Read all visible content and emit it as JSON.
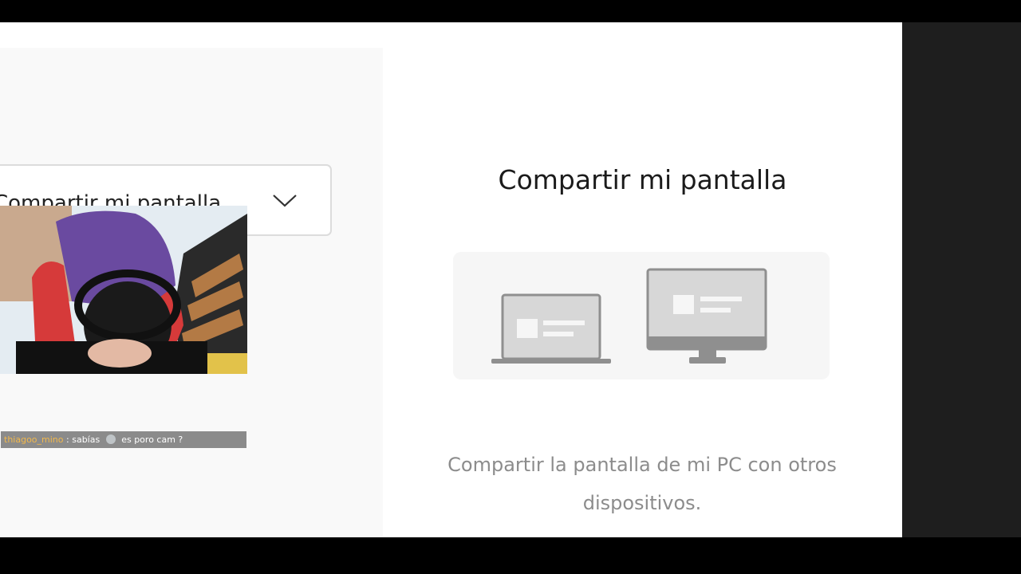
{
  "dropdown": {
    "selected_label": "Compartir mi pantalla",
    "icon": "chevron-down-icon"
  },
  "stream_overlay": {
    "chat": {
      "username": "thiagoo_mino",
      "separator": ":",
      "message_part1": "sabías",
      "emoji": "skull-emoji-icon",
      "message_part2": "es poro cam ?"
    }
  },
  "panel": {
    "title": "Compartir mi pantalla",
    "description": "Compartir la pantalla de mi PC con otros dispositivos.",
    "illustration_icons": [
      "laptop-icon",
      "monitor-icon"
    ]
  },
  "colors": {
    "chat_username": "#f2b84b",
    "icon_gray": "#8f8f8f",
    "icon_screen": "#d7d7d7"
  }
}
